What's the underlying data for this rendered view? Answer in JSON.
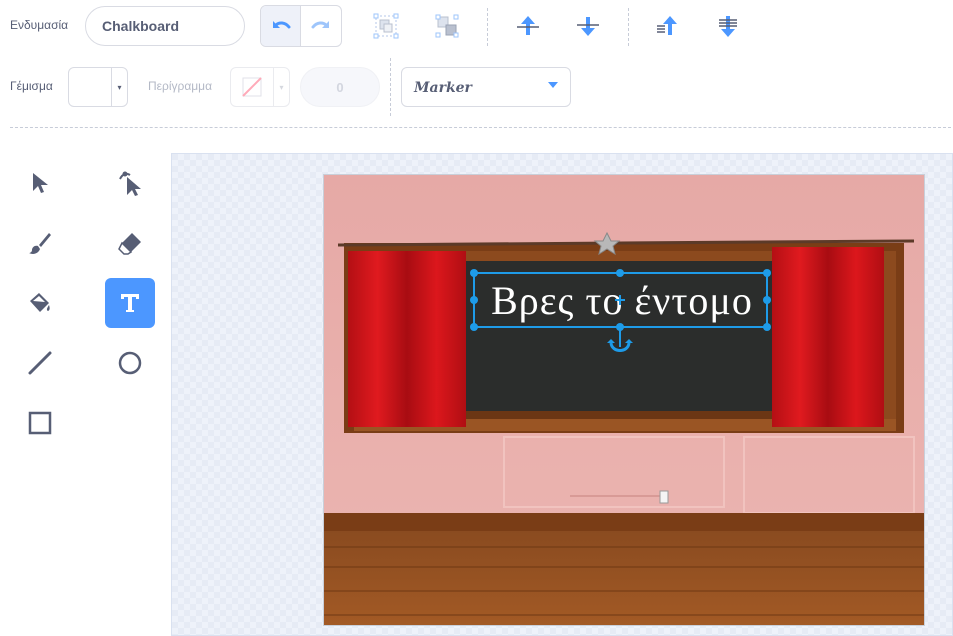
{
  "toolbar": {
    "costume_label": "Ενδυμασία",
    "costume_name": "Chalkboard",
    "undo_icon": "undo-icon",
    "redo_icon": "redo-icon",
    "group_icon": "group-icon",
    "ungroup_icon": "ungroup-icon",
    "forward_icon": "forward-icon",
    "backward_icon": "backward-icon",
    "front_icon": "front-icon",
    "back_icon": "back-icon"
  },
  "style": {
    "fill_label": "Γέμισμα",
    "fill_color": "#ffffff",
    "outline_label": "Περίγραμμα",
    "outline_width": "0",
    "font_name": "Marker",
    "accent_color": "#4c97ff"
  },
  "tools": [
    {
      "name": "select-tool",
      "icon": "arrow-cursor-icon",
      "active": false
    },
    {
      "name": "reshape-tool",
      "icon": "reshape-cursor-icon",
      "active": false
    },
    {
      "name": "brush-tool",
      "icon": "brush-icon",
      "active": false
    },
    {
      "name": "eraser-tool",
      "icon": "eraser-icon",
      "active": false
    },
    {
      "name": "fill-tool",
      "icon": "paint-bucket-icon",
      "active": false
    },
    {
      "name": "text-tool",
      "icon": "text-icon",
      "active": true
    },
    {
      "name": "line-tool",
      "icon": "line-icon",
      "active": false
    },
    {
      "name": "circle-tool",
      "icon": "circle-icon",
      "active": false
    },
    {
      "name": "rectangle-tool",
      "icon": "rectangle-icon",
      "active": false
    }
  ],
  "canvas": {
    "text": "Βρες το έντομο"
  }
}
